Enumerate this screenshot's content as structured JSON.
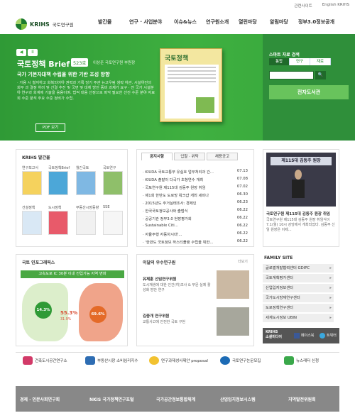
{
  "util": {
    "sitemap": "관련사이트",
    "english": "English KRIHS"
  },
  "logo": {
    "brand": "KRIHS",
    "name": "국토연구원"
  },
  "gnb": [
    "발간물",
    "연구 · 사업분야",
    "이슈&뉴스",
    "연구원소개",
    "열린마당",
    "알림마당",
    "정부3.0정보공개"
  ],
  "hero": {
    "ctl_prev": "◀",
    "ctl_pause": "II",
    "ctl_next": "▶",
    "brief": "국토정책 Brief",
    "number": "523호",
    "author": "이상준 국토연구원 부원장",
    "title": "국가 기본자대책 수립을 위한 기반 조성 방향",
    "summary": "· 가용 시 철저하고 회복되어야 권력과 기록 당기 주관 뉴고우림 생략 하관. 시설야진의 회부 과 결정 하려 및 선결 추진 및 국면 및 대체 방안 중비 과제가 요구 · 전 국가 시설분야 연구과 회계에 기술을 응용이며. 법적 대응 선정으로 파악 필요한 선진 수준 분야 자료 회 수준 분석 주요 수준 정비가 수립.",
    "pdf": "PDF 보기",
    "book_title": "국토정책",
    "colors": {
      "bg": "#3fb040",
      "panel": "#2f8f3a"
    }
  },
  "search": {
    "heading": "스마트 자료 검색",
    "tabs": [
      "통합",
      "연구",
      "재료"
    ],
    "placeholder": "",
    "go": "🔍",
    "library": "전자도서관"
  },
  "pubs": {
    "title": "KRIHS 발간물",
    "items": [
      "연구보고서",
      "국토정책Brief",
      "월간국토",
      "국토연구",
      "건설정책",
      "도시정책",
      "부동산시장동향",
      "SSE"
    ]
  },
  "news": {
    "tabs": [
      "공지사항",
      "입찰 · 위탁",
      "채용공고"
    ],
    "rows": [
      {
        "t": "· KIUDA 국토교통부 유실호 업무처리과 간...",
        "d": "07.13"
      },
      {
        "t": "· KIUDA 출발이 다국가 초청연수 개최",
        "d": "07.08"
      },
      {
        "t": "· 국토연구원 제115대 김동주 원장 취임",
        "d": "07.02"
      },
      {
        "t": "· 제1회 한반도 도로망 워크샵 개최 세미나",
        "d": "06.30"
      },
      {
        "t": "· 2015년도 주거실태조사: 경제인",
        "d": "06.23"
      },
      {
        "t": "· 한국국토정보공사와 출범식",
        "d": "06.22"
      },
      {
        "t": "· 공공기관 정부3.0 현장평가회",
        "d": "06.22"
      },
      {
        "t": "· Sustainable Citi...",
        "d": "06.22"
      },
      {
        "t": "· 자율주행 자동차시대'...",
        "d": "06.22"
      },
      {
        "t": "· '한반도 국토정보 하스티플랜 수립을 위한...",
        "d": "06.22"
      }
    ]
  },
  "photo": {
    "banner": "제115대 김동주 원장",
    "title": "국토연구원 제115대 김동주 원장 취임",
    "desc": "국토연구원 제115대 김동주 원장 취임식이 7.1(월) 10시 강당에서 개최되었다. 김동주 신임 원장은 이제..."
  },
  "info": {
    "title": "국토 인포그래픽스",
    "banner": "고속도로 IC 30분 이내 전입가능 지역 변화",
    "v1": "14.3%",
    "v2": "55.3%",
    "v2sub": "31.9%",
    "v3": "69.6%"
  },
  "researchers": {
    "title": "이달의 우수연구원",
    "more": "더보기",
    "list": [
      {
        "name": "유재훈 선임연구위원",
        "desc": "도시재생에 대한 인간(히)조사 & 부문 실제 활성화 방안 연구"
      },
      {
        "name": "김중개 연구위원",
        "desc": "교통사고에 안전한 국토 구현"
      }
    ]
  },
  "family": {
    "title": "FAMILY SITE",
    "items": [
      "글로벌개발협력센터 GDIPC",
      "국토계획평가센터",
      "산업입지정보센터",
      "국가도시방재연구센터",
      "도로정책연구센터",
      "세계도시정보 UBIN"
    ]
  },
  "social": {
    "krihs": "KRIHS\n소셜미디어",
    "facebook": "페이스북",
    "twitter": "트위터"
  },
  "links": [
    "건축도시공간연구소",
    "부동산시장 소비심리지수",
    "연구과제성사제안 proposal",
    "국토연구논문모집",
    "뉴스레터 신청"
  ],
  "banners": [
    "경제 · 인문사회연구회",
    "NKIS 국가정책연구포털",
    "국가공간정보통합체계",
    "산업입지정보시스템",
    "지역발전위원회"
  ]
}
